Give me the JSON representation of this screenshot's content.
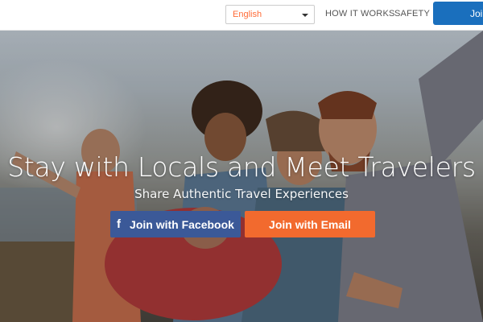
{
  "topbar": {
    "language_select": {
      "selected": "English"
    },
    "nav": [
      {
        "label": "HOW IT WORKS"
      },
      {
        "label": "SAFETY"
      }
    ],
    "join_button_label": "Join"
  },
  "hero": {
    "title": "Stay with Locals and Meet Travelers",
    "subtitle": "Share Authentic Travel Experiences",
    "facebook_button_label": "Join with Facebook",
    "facebook_icon_glyph": "f",
    "email_button_label": "Join with Email"
  },
  "colors": {
    "facebook_blue": "#3b5998",
    "email_orange": "#f26a2e",
    "join_blue": "#1a6fbd",
    "language_text": "#ff6b37"
  }
}
